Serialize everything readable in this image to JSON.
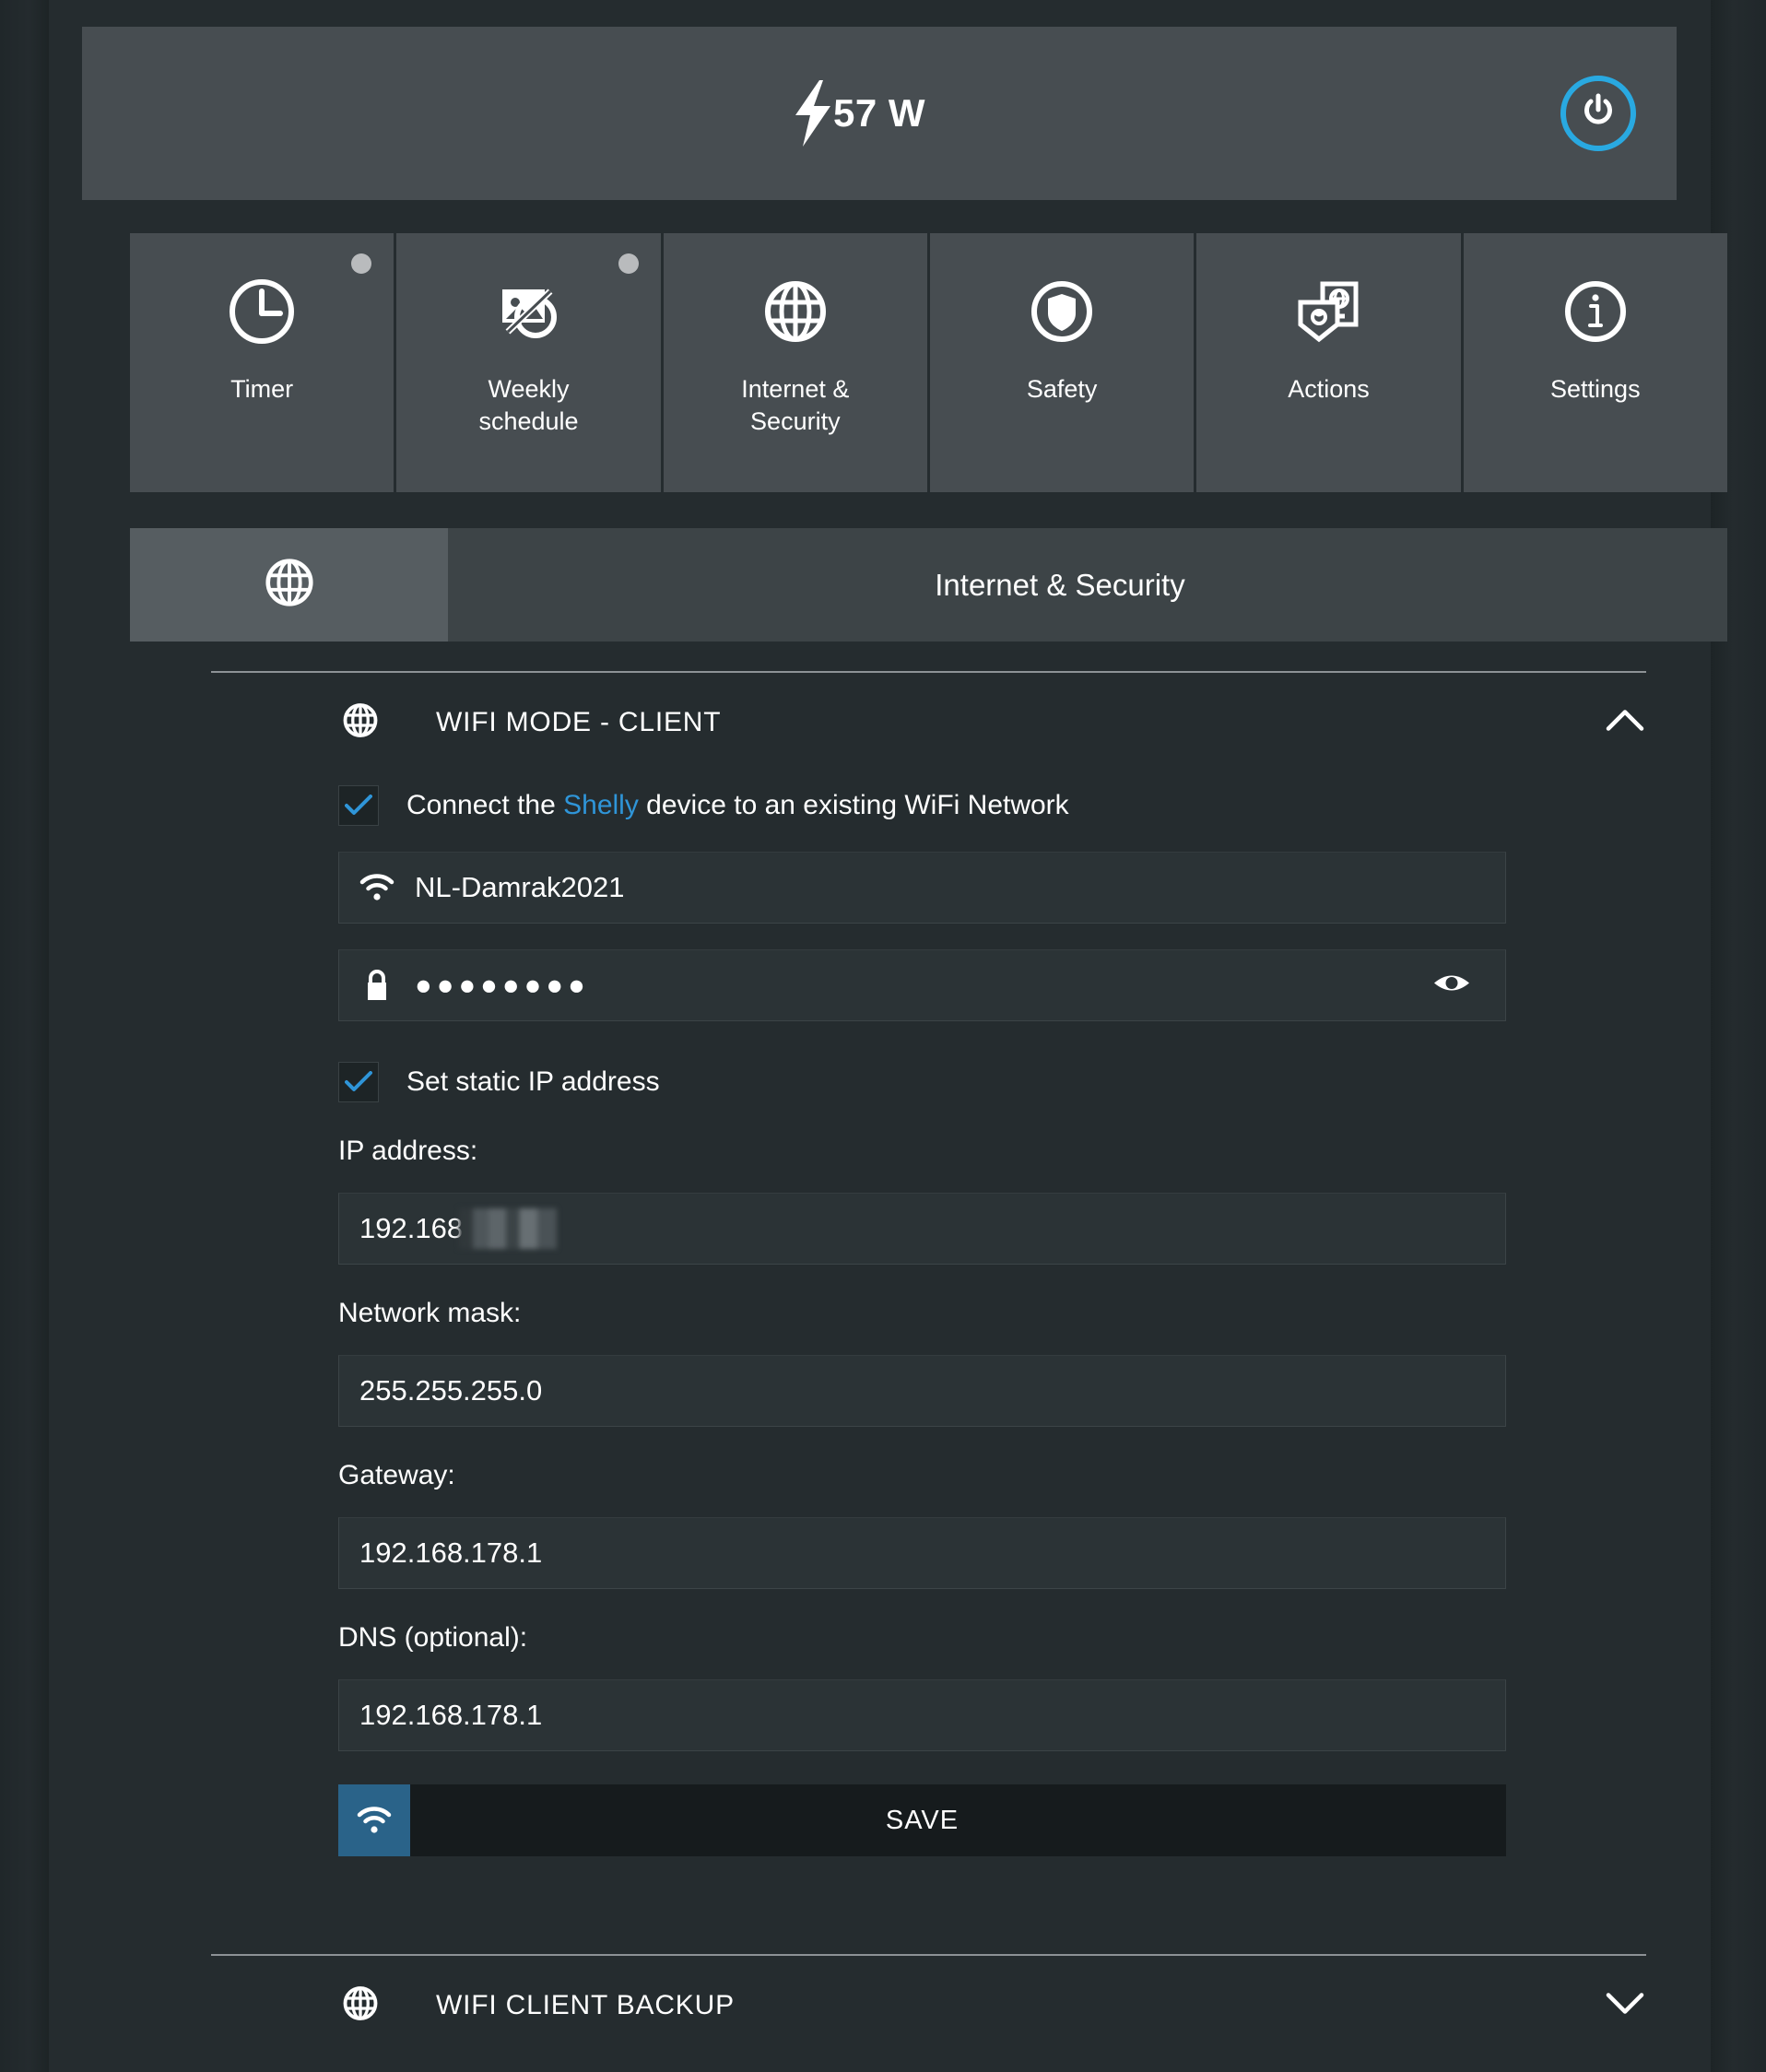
{
  "header": {
    "bolt_icon": "lightning-bolt-icon",
    "power_value": "57 W",
    "power_button_icon": "power-icon",
    "accent_color": "#29a9e1"
  },
  "tiles": [
    {
      "label": "Timer",
      "icon": "clock-icon",
      "badge": true
    },
    {
      "label": "Weekly\nschedule",
      "icon": "image-slash-icon",
      "badge": true
    },
    {
      "label": "Internet &\nSecurity",
      "icon": "globe-icon",
      "badge": false
    },
    {
      "label": "Safety",
      "icon": "shield-circle-icon",
      "badge": false
    },
    {
      "label": "Actions",
      "icon": "actions-icon",
      "badge": false
    },
    {
      "label": "Settings",
      "icon": "info-circle-icon",
      "badge": false
    }
  ],
  "section": {
    "icon": "globe-icon",
    "title": "Internet & Security"
  },
  "wifi_mode": {
    "icon": "globe-icon",
    "title": "WIFI MODE - CLIENT",
    "chevron": "chevron-up-icon",
    "connect_checkbox": {
      "checked": true,
      "label_before": "Connect the ",
      "label_accent": "Shelly",
      "label_after": " device to an existing WiFi Network"
    },
    "ssid": {
      "icon": "wifi-icon",
      "value": "NL-Damrak2021"
    },
    "password": {
      "icon": "lock-icon",
      "value": "●●●●●●●●",
      "reveal_icon": "eye-icon"
    },
    "static_ip_checkbox": {
      "checked": true,
      "label": "Set static IP address"
    },
    "ip_address": {
      "label": "IP address:",
      "value": "192.168",
      "redacted": true
    },
    "network_mask": {
      "label": "Network mask:",
      "value": "255.255.255.0"
    },
    "gateway": {
      "label": "Gateway:",
      "value": "192.168.178.1"
    },
    "dns": {
      "label": "DNS (optional):",
      "value": "192.168.178.1"
    },
    "save": {
      "icon": "wifi-icon",
      "label": "SAVE",
      "icon_bg": "#2a6389"
    }
  },
  "wifi_backup": {
    "icon": "globe-icon",
    "title": "WIFI CLIENT BACKUP",
    "chevron": "chevron-down-icon"
  }
}
